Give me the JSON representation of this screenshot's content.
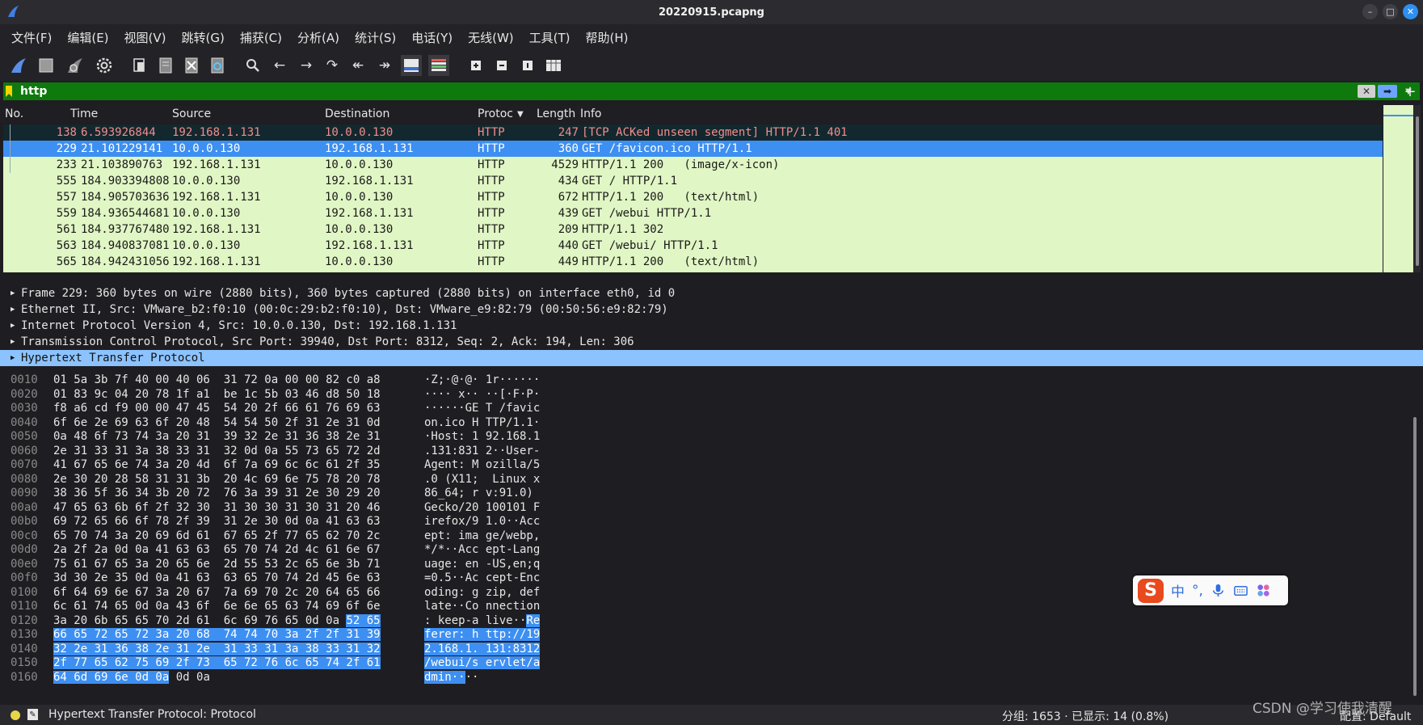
{
  "window": {
    "title": "20220915.pcapng"
  },
  "menu": [
    "文件(F)",
    "编辑(E)",
    "视图(V)",
    "跳转(G)",
    "捕获(C)",
    "分析(A)",
    "统计(S)",
    "电话(Y)",
    "无线(W)",
    "工具(T)",
    "帮助(H)"
  ],
  "filter": {
    "value": "http"
  },
  "columns": [
    "No.",
    "Time",
    "Source",
    "Destination",
    "Protoc",
    "Length",
    "Info"
  ],
  "packets": [
    {
      "no": "138",
      "time": "6.593926844",
      "src": "192.168.1.131",
      "dst": "10.0.0.130",
      "proto": "HTTP",
      "len": "247",
      "info": "[TCP ACKed unseen segment] HTTP/1.1 401"
    },
    {
      "no": "229",
      "time": "21.101229141",
      "src": "10.0.0.130",
      "dst": "192.168.1.131",
      "proto": "HTTP",
      "len": "360",
      "info": "GET /favicon.ico HTTP/1.1"
    },
    {
      "no": "233",
      "time": "21.103890763",
      "src": "192.168.1.131",
      "dst": "10.0.0.130",
      "proto": "HTTP",
      "len": "4529",
      "info": "HTTP/1.1 200   (image/x-icon)"
    },
    {
      "no": "555",
      "time": "184.903394808",
      "src": "10.0.0.130",
      "dst": "192.168.1.131",
      "proto": "HTTP",
      "len": "434",
      "info": "GET / HTTP/1.1"
    },
    {
      "no": "557",
      "time": "184.905703636",
      "src": "192.168.1.131",
      "dst": "10.0.0.130",
      "proto": "HTTP",
      "len": "672",
      "info": "HTTP/1.1 200   (text/html)"
    },
    {
      "no": "559",
      "time": "184.936544681",
      "src": "10.0.0.130",
      "dst": "192.168.1.131",
      "proto": "HTTP",
      "len": "439",
      "info": "GET /webui HTTP/1.1"
    },
    {
      "no": "561",
      "time": "184.937767480",
      "src": "192.168.1.131",
      "dst": "10.0.0.130",
      "proto": "HTTP",
      "len": "209",
      "info": "HTTP/1.1 302"
    },
    {
      "no": "563",
      "time": "184.940837081",
      "src": "10.0.0.130",
      "dst": "192.168.1.131",
      "proto": "HTTP",
      "len": "440",
      "info": "GET /webui/ HTTP/1.1"
    },
    {
      "no": "565",
      "time": "184.942431056",
      "src": "192.168.1.131",
      "dst": "10.0.0.130",
      "proto": "HTTP",
      "len": "449",
      "info": "HTTP/1.1 200   (text/html)"
    }
  ],
  "details": [
    "Frame 229: 360 bytes on wire (2880 bits), 360 bytes captured (2880 bits) on interface eth0, id 0",
    "Ethernet II, Src: VMware_b2:f0:10 (00:0c:29:b2:f0:10), Dst: VMware_e9:82:79 (00:50:56:e9:82:79)",
    "Internet Protocol Version 4, Src: 10.0.0.130, Dst: 192.168.1.131",
    "Transmission Control Protocol, Src Port: 39940, Dst Port: 8312, Seq: 2, Ack: 194, Len: 306",
    "Hypertext Transfer Protocol"
  ],
  "hex": [
    {
      "off": "0010",
      "hex": "01 5a 3b 7f 40 00 40 06  31 72 0a 00 00 82 c0 a8",
      "ascii": "·Z;·@·@· 1r······"
    },
    {
      "off": "0020",
      "hex": "01 83 9c 04 20 78 1f a1  be 1c 5b 03 46 d8 50 18",
      "ascii": "···· x·· ··[·F·P·"
    },
    {
      "off": "0030",
      "hex": "f8 a6 cd f9 00 00 47 45  54 20 2f 66 61 76 69 63",
      "ascii": "······GE T /favic"
    },
    {
      "off": "0040",
      "hex": "6f 6e 2e 69 63 6f 20 48  54 54 50 2f 31 2e 31 0d",
      "ascii": "on.ico H TTP/1.1·"
    },
    {
      "off": "0050",
      "hex": "0a 48 6f 73 74 3a 20 31  39 32 2e 31 36 38 2e 31",
      "ascii": "·Host: 1 92.168.1"
    },
    {
      "off": "0060",
      "hex": "2e 31 33 31 3a 38 33 31  32 0d 0a 55 73 65 72 2d",
      "ascii": ".131:831 2··User-"
    },
    {
      "off": "0070",
      "hex": "41 67 65 6e 74 3a 20 4d  6f 7a 69 6c 6c 61 2f 35",
      "ascii": "Agent: M ozilla/5"
    },
    {
      "off": "0080",
      "hex": "2e 30 20 28 58 31 31 3b  20 4c 69 6e 75 78 20 78",
      "ascii": ".0 (X11;  Linux x"
    },
    {
      "off": "0090",
      "hex": "38 36 5f 36 34 3b 20 72  76 3a 39 31 2e 30 29 20",
      "ascii": "86_64; r v:91.0) "
    },
    {
      "off": "00a0",
      "hex": "47 65 63 6b 6f 2f 32 30  31 30 30 31 30 31 20 46",
      "ascii": "Gecko/20 100101 F"
    },
    {
      "off": "00b0",
      "hex": "69 72 65 66 6f 78 2f 39  31 2e 30 0d 0a 41 63 63",
      "ascii": "irefox/9 1.0··Acc"
    },
    {
      "off": "00c0",
      "hex": "65 70 74 3a 20 69 6d 61  67 65 2f 77 65 62 70 2c",
      "ascii": "ept: ima ge/webp,"
    },
    {
      "off": "00d0",
      "hex": "2a 2f 2a 0d 0a 41 63 63  65 70 74 2d 4c 61 6e 67",
      "ascii": "*/*··Acc ept-Lang"
    },
    {
      "off": "00e0",
      "hex": "75 61 67 65 3a 20 65 6e  2d 55 53 2c 65 6e 3b 71",
      "ascii": "uage: en -US,en;q"
    },
    {
      "off": "00f0",
      "hex": "3d 30 2e 35 0d 0a 41 63  63 65 70 74 2d 45 6e 63",
      "ascii": "=0.5··Ac cept-Enc"
    },
    {
      "off": "0100",
      "hex": "6f 64 69 6e 67 3a 20 67  7a 69 70 2c 20 64 65 66",
      "ascii": "oding: g zip, def"
    },
    {
      "off": "0110",
      "hex": "6c 61 74 65 0d 0a 43 6f  6e 6e 65 63 74 69 6f 6e",
      "ascii": "late··Co nnection"
    },
    {
      "off": "0120",
      "hex": "3a 20 6b 65 65 70 2d 61  6c 69 76 65 0d 0a ",
      "hexhl": "52 65",
      "ascii": ": keep-a live··",
      "aschl": "Re"
    },
    {
      "off": "0130",
      "hex": "",
      "hexhl": "66 65 72 65 72 3a 20 68  74 74 70 3a 2f 2f 31 39",
      "ascii": "",
      "aschl": "ferer: h ttp://19"
    },
    {
      "off": "0140",
      "hex": "",
      "hexhl": "32 2e 31 36 38 2e 31 2e  31 33 31 3a 38 33 31 32",
      "ascii": "",
      "aschl": "2.168.1. 131:8312"
    },
    {
      "off": "0150",
      "hex": "",
      "hexhl": "2f 77 65 62 75 69 2f 73  65 72 76 6c 65 74 2f 61",
      "ascii": "",
      "aschl": "/webui/s ervlet/a"
    },
    {
      "off": "0160",
      "hex": "",
      "hexhl": "64 6d 69 6e 0d 0a",
      "hexrest": " 0d 0a",
      "ascii": "",
      "aschl": "dmin··",
      "ascrest": "··"
    }
  ],
  "ime": {
    "label1": "中",
    "label2": "°,"
  },
  "status": {
    "left": "Hypertext Transfer Protocol: Protocol",
    "right": "分组: 1653 · 已显示: 14 (0.8%)",
    "profile": "配置: Default"
  },
  "watermark": "CSDN @学习使我清醒"
}
